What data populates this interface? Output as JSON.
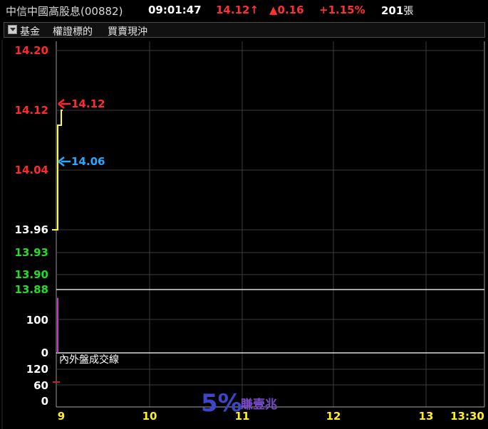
{
  "header": {
    "stock_name": "中信中國高股息(00882)",
    "time": "09:01:47",
    "price": "14.12",
    "change": "0.16",
    "change_pct": "+1.15%",
    "volume": "201",
    "volume_unit": "張"
  },
  "menu": {
    "items": [
      "基金",
      "權證標的",
      "買賣現沖"
    ]
  },
  "price_axis": {
    "labels": [
      {
        "text": "14.20",
        "color": "#ff2a2a"
      },
      {
        "text": "14.12",
        "color": "#ff2a2a"
      },
      {
        "text": "14.04",
        "color": "#ff2a2a"
      },
      {
        "text": "13.96",
        "color": "#ffffff"
      },
      {
        "text": "13.93",
        "color": "#22dd22"
      },
      {
        "text": "13.90",
        "color": "#22dd22"
      },
      {
        "text": "13.88",
        "color": "#22dd22"
      }
    ]
  },
  "volume_axis": {
    "labels": [
      "100",
      "0"
    ]
  },
  "bs_axis": {
    "labels": [
      "120",
      "60",
      "0"
    ],
    "title": "內外盤成交線"
  },
  "time_axis": {
    "labels": [
      "9",
      "10",
      "11",
      "12",
      "13",
      "13:30"
    ]
  },
  "annotations": {
    "high": "14.12",
    "average": "14.06"
  },
  "watermark": {
    "big": "5%",
    "small": "賺壹兆"
  },
  "chart_data": [
    {
      "type": "line",
      "title": "",
      "x": [
        "09:00",
        "09:01",
        "09:01",
        "09:01",
        "09:01"
      ],
      "series": [
        {
          "values": [
            13.96,
            13.96,
            14.1,
            14.1,
            14.12
          ]
        }
      ],
      "ylim": [
        13.88,
        14.2
      ],
      "colors": {
        "price": "#ffff33",
        "high_arrow": "#ff2a2a",
        "avg_arrow": "#29a8ff"
      }
    },
    {
      "type": "bar",
      "title": "",
      "categories": [
        "09:00"
      ],
      "values": [
        180
      ],
      "ylim": [
        0,
        200
      ],
      "colors": {
        "volume": "#cc33cc"
      }
    }
  ]
}
